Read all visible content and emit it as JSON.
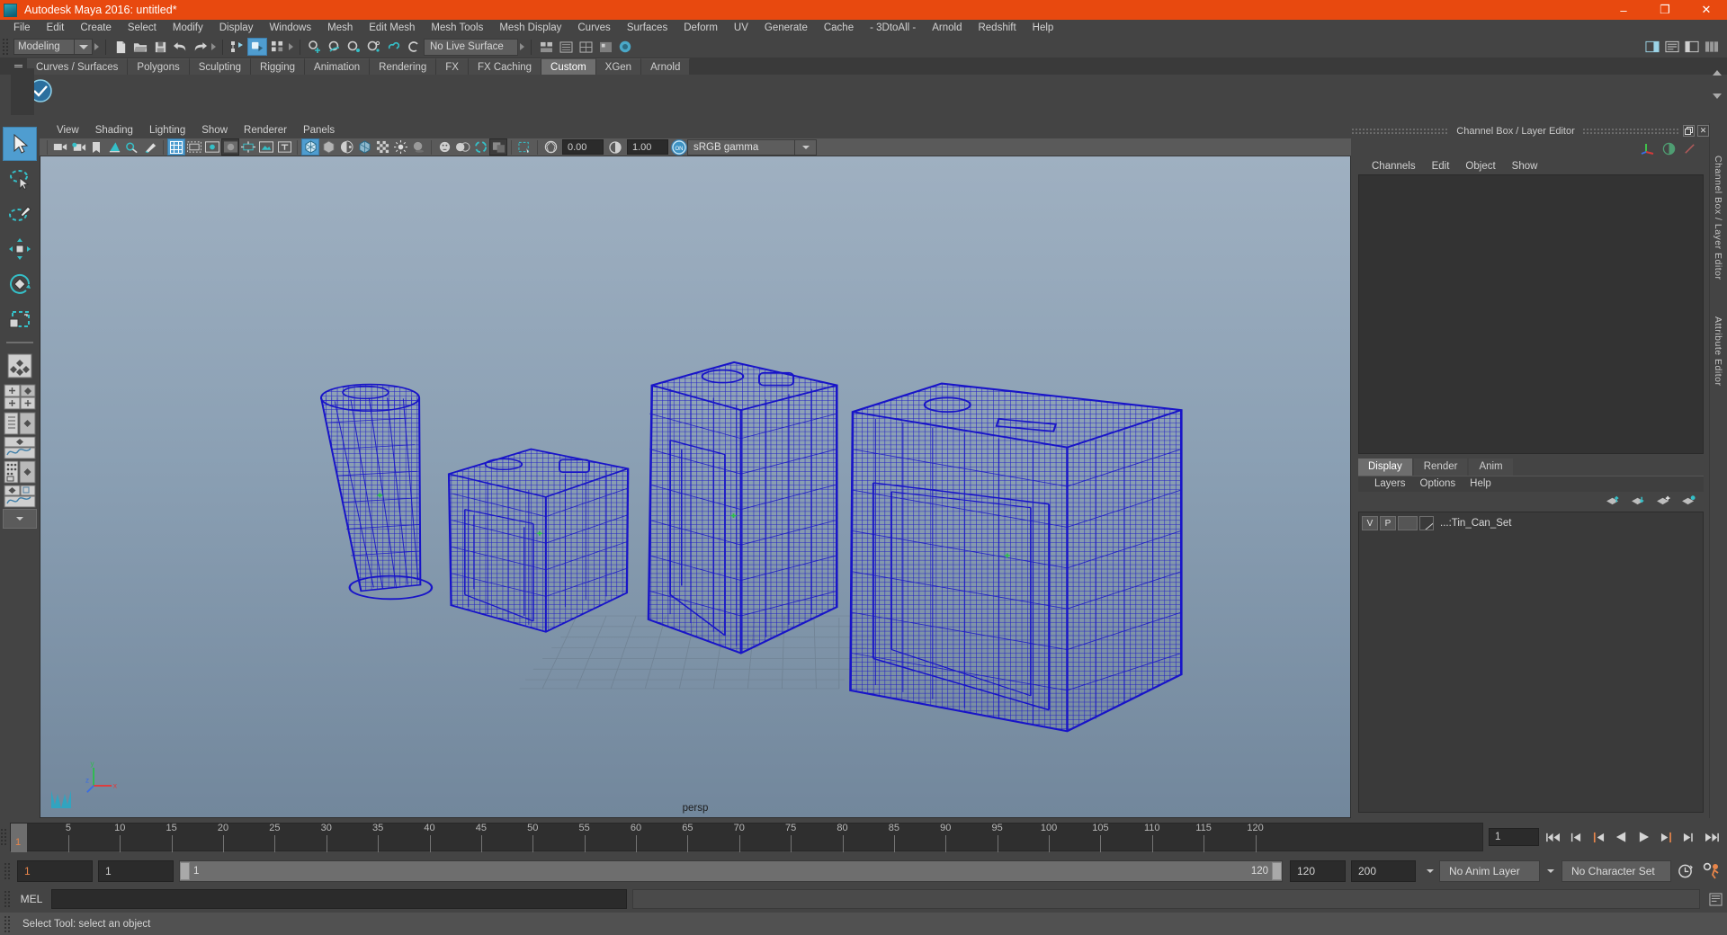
{
  "window": {
    "title": "Autodesk Maya 2016: untitled*",
    "minimize": "–",
    "maximize": "❐",
    "close": "✕",
    "app_icon": "maya-app-icon"
  },
  "menubar": {
    "items": [
      "File",
      "Edit",
      "Create",
      "Select",
      "Modify",
      "Display",
      "Windows",
      "Mesh",
      "Edit Mesh",
      "Mesh Tools",
      "Mesh Display",
      "Curves",
      "Surfaces",
      "Deform",
      "UV",
      "Generate",
      "Cache",
      "- 3DtoAll -",
      "Arnold",
      "Redshift",
      "Help"
    ]
  },
  "statusbar": {
    "menuset": "Modeling",
    "live_surface": "No Live Surface"
  },
  "shelf": {
    "tabs": [
      "Curves / Surfaces",
      "Polygons",
      "Sculpting",
      "Rigging",
      "Animation",
      "Rendering",
      "FX",
      "FX Caching",
      "Custom",
      "XGen",
      "Arnold"
    ],
    "active_tab": "Custom"
  },
  "viewport": {
    "menus": [
      "View",
      "Shading",
      "Lighting",
      "Show",
      "Renderer",
      "Panels"
    ],
    "exposure": "0.00",
    "gamma": "1.00",
    "color_profile": "sRGB gamma",
    "camera_label": "persp",
    "axis_x": "x",
    "axis_y": "y",
    "axis_z": "z",
    "background_top": "#9aabbd",
    "background_bottom": "#74889d",
    "wireframe_color": "#1814c8"
  },
  "channelbox": {
    "panel_title": "Channel Box / Layer Editor",
    "menus": [
      "Channels",
      "Edit",
      "Object",
      "Show"
    ],
    "vertical_tabs": [
      "Channel Box / Layer Editor",
      "Attribute Editor"
    ]
  },
  "layereditor": {
    "tabs": [
      "Display",
      "Render",
      "Anim"
    ],
    "active_tab": "Display",
    "menus": [
      "Layers",
      "Options",
      "Help"
    ],
    "layers": [
      {
        "visible": "V",
        "playback": "P",
        "name": "...:Tin_Can_Set"
      }
    ]
  },
  "timeline": {
    "ticks": [
      5,
      10,
      15,
      20,
      25,
      30,
      35,
      40,
      45,
      50,
      55,
      60,
      65,
      70,
      75,
      80,
      85,
      90,
      95,
      100,
      105,
      110,
      115,
      120
    ],
    "current_frame": "1",
    "frame_field": "1"
  },
  "rangeslider": {
    "start": "1",
    "anim_start": "1",
    "range_start_label": "1",
    "range_end_label": "120",
    "anim_end": "120",
    "end": "200",
    "anim_layer": "No Anim Layer",
    "character_set": "No Character Set"
  },
  "commandline": {
    "language": "MEL",
    "input_value": "",
    "output_value": ""
  },
  "helpline": {
    "message": "Select Tool: select an object"
  },
  "toolbox": {
    "items": [
      {
        "name": "select-tool",
        "selected": true
      },
      {
        "name": "lasso-select-tool",
        "selected": false
      },
      {
        "name": "paint-select-tool",
        "selected": false
      },
      {
        "name": "move-tool",
        "selected": false
      },
      {
        "name": "rotate-tool",
        "selected": false
      },
      {
        "name": "scale-tool",
        "selected": false
      },
      {
        "name": "last-tool-used",
        "selected": false
      }
    ],
    "layouts": [
      "single-perspective-view",
      "four-view",
      "outliner-persp-view",
      "persp-graph-view",
      "hypershade-persp-view",
      "persp-uv-view"
    ]
  },
  "chart_data": null
}
